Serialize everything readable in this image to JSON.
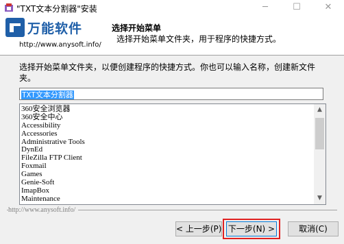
{
  "window": {
    "title": "\"TXT文本分割器\"安装",
    "minimize_icon": "minimize-icon",
    "maximize_icon": "maximize-icon",
    "close_icon": "close-icon"
  },
  "header": {
    "logo_text": "万能软件",
    "logo_url": "http://www.anysoft.info/",
    "title": "选择开始菜单",
    "subtitle": "选择开始菜单文件夹，用于程序的快捷方式。"
  },
  "body": {
    "description": "选择开始菜单文件夹，以便创建程序的快捷方式。你也可以输入名称，创建新文件夹。",
    "folder_value": "TXT文本分割器",
    "folders": [
      "360安全浏览器",
      "360安全中心",
      "Accessibility",
      "Accessories",
      "Administrative Tools",
      "DynEd",
      "FileZilla FTP Client",
      "Foxmail",
      "Games",
      "Genie-Soft",
      "ImapBox",
      "Maintenance"
    ]
  },
  "footer": {
    "brand": "http://www.anysoft.info/",
    "back_label": "< 上一步(P)",
    "next_label": "下一步(N) >",
    "cancel_label": "取消(C)"
  },
  "colors": {
    "accent": "#1f5fa8",
    "selection": "#3399ff",
    "highlight_box": "#e02020"
  }
}
